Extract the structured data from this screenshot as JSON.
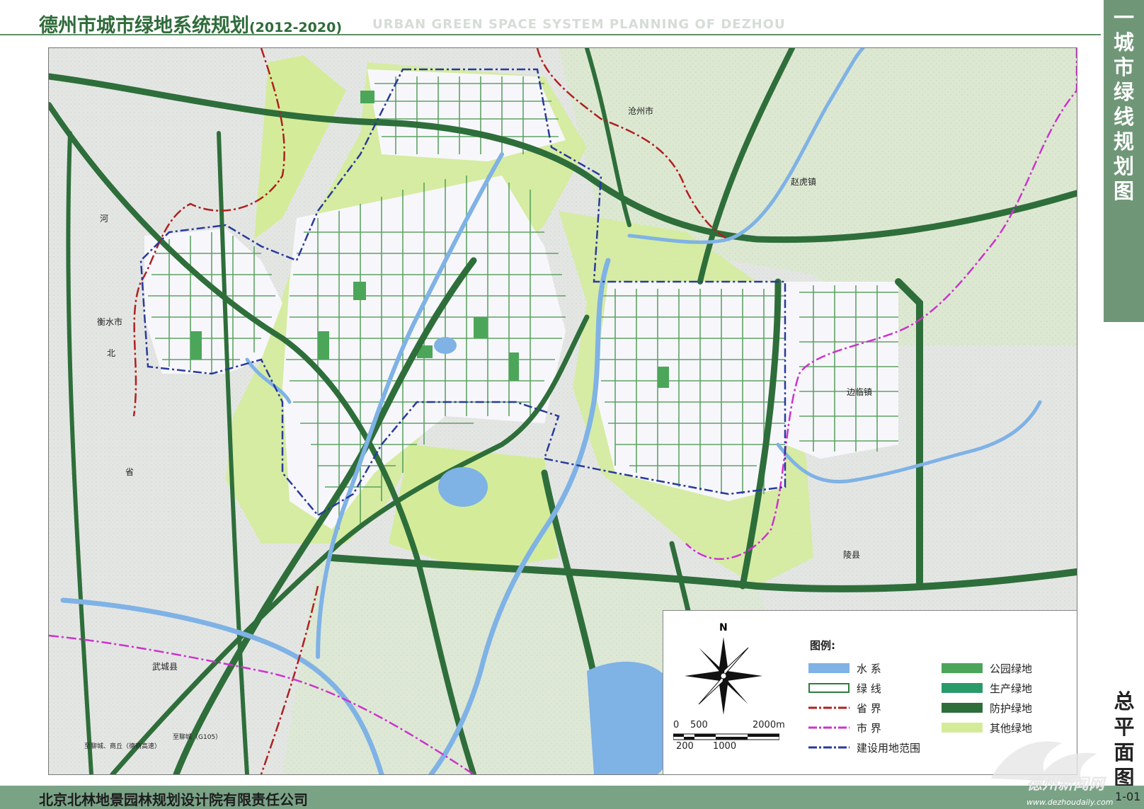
{
  "header": {
    "title": "德州市城市绿地系统规划",
    "years": "(2012-2020)",
    "title_en": "URBAN GREEN SPACE SYSTEM PLANNING OF DEZHOU"
  },
  "side": {
    "top_text": "一 城市绿线规划图",
    "bottom_text": "总平面图"
  },
  "footer": {
    "organization": "北京北林地景园林规划设计院有限责任公司",
    "sheet_number": "1-01"
  },
  "map_labels": {
    "cangzhou": "沧州市",
    "zhaohu": "赵虎镇",
    "he": "河",
    "bei": "北",
    "hengshui": "衡水市",
    "sheng": "省",
    "bianlin": "边临镇",
    "lingxian": "陵县",
    "wucheng": "武城县",
    "road_g105": "至聊城（G105）",
    "road_dezhou_shang": "至聊城、商丘（德商高速）"
  },
  "legend": {
    "title": "图例:",
    "north": "N",
    "items_left": [
      {
        "label": "水  系",
        "color": "#7fb2e5",
        "style": "fill"
      },
      {
        "label": "绿  线",
        "color": "#2f7d3f",
        "style": "outline"
      },
      {
        "label": "省  界",
        "color": "#b02020",
        "style": "dashdot"
      },
      {
        "label": "市  界",
        "color": "#cc33cc",
        "style": "dashdot"
      },
      {
        "label": "建设用地范围",
        "color": "#2a3a9a",
        "style": "dashdot"
      }
    ],
    "items_right": [
      {
        "label": "公园绿地",
        "color": "#4ca65a"
      },
      {
        "label": "生产绿地",
        "color": "#2a9a6a"
      },
      {
        "label": "防护绿地",
        "color": "#2e6e3a"
      },
      {
        "label": "其他绿地",
        "color": "#d4ec9a"
      }
    ],
    "scale": {
      "top": [
        "0",
        "500",
        "2000m"
      ],
      "bottom": [
        "200",
        "1000"
      ]
    }
  },
  "watermark": {
    "text": "德州新闻网",
    "url": "www.dezhoudaily.com"
  },
  "colors": {
    "water": "#7fb2e5",
    "park_green": "#4ca65a",
    "protective_green": "#2e6e3a",
    "other_green": "#d4ec9a",
    "province_boundary": "#b02020",
    "city_boundary": "#cc33cc",
    "construction_boundary": "#2a3a9a"
  }
}
